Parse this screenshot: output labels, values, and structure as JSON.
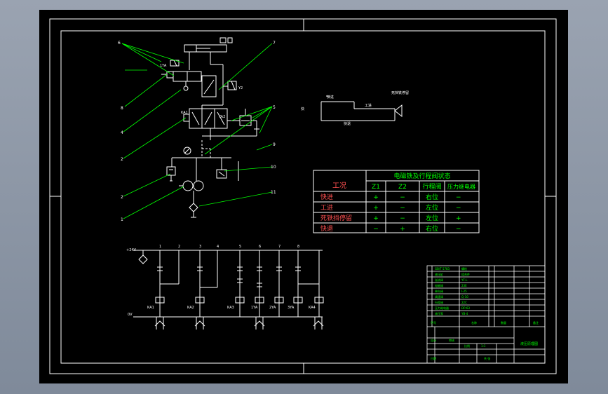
{
  "colors": {
    "background": "#8f99a8",
    "sheet": "#000000",
    "line": "#ffffff",
    "leader": "#00ff00",
    "table_border": "#ffffff",
    "table_text_green": "#00ff00",
    "table_text_red": "#ff5050"
  },
  "hydraulic": {
    "callouts": [
      "6",
      "8",
      "4",
      "2",
      "2",
      "1",
      "7",
      "5",
      "9",
      "10",
      "11"
    ],
    "valve_labels": {
      "y1": "1YA",
      "y2": "Y2",
      "y3": "YA2",
      "k1": "KA1"
    }
  },
  "speed_diagram": {
    "fast_forward": "快进",
    "work_feed": "工进",
    "dead_stop": "死挡铁停留",
    "return": "快退"
  },
  "state_table": {
    "title": "电磁铁及行程阀状态",
    "headers": [
      "工况",
      "Z1",
      "Z2",
      "行程阀",
      "压力继电器"
    ],
    "rows": [
      {
        "mode": "快进",
        "z1": "+",
        "z2": "−",
        "valve": "右位",
        "relay": "−"
      },
      {
        "mode": "工进",
        "z1": "+",
        "z2": "−",
        "valve": "左位",
        "relay": "−"
      },
      {
        "mode": "死铁挡停留",
        "z1": "+",
        "z2": "−",
        "valve": "左位",
        "relay": "+"
      },
      {
        "mode": "快退",
        "z1": "−",
        "z2": "+",
        "valve": "右位",
        "relay": "−"
      }
    ]
  },
  "ladder": {
    "rail_top": "+24V",
    "rail_bottom": "0V",
    "columns": [
      "1",
      "2",
      "3",
      "4",
      "5",
      "6",
      "7",
      "8"
    ],
    "coils": [
      "KA1",
      "KA2",
      "KA3",
      "1YA",
      "2YA",
      "3YA",
      "KA4"
    ]
  },
  "title_block": {
    "drawing_title": "液压原理图",
    "scale": "1:1"
  }
}
